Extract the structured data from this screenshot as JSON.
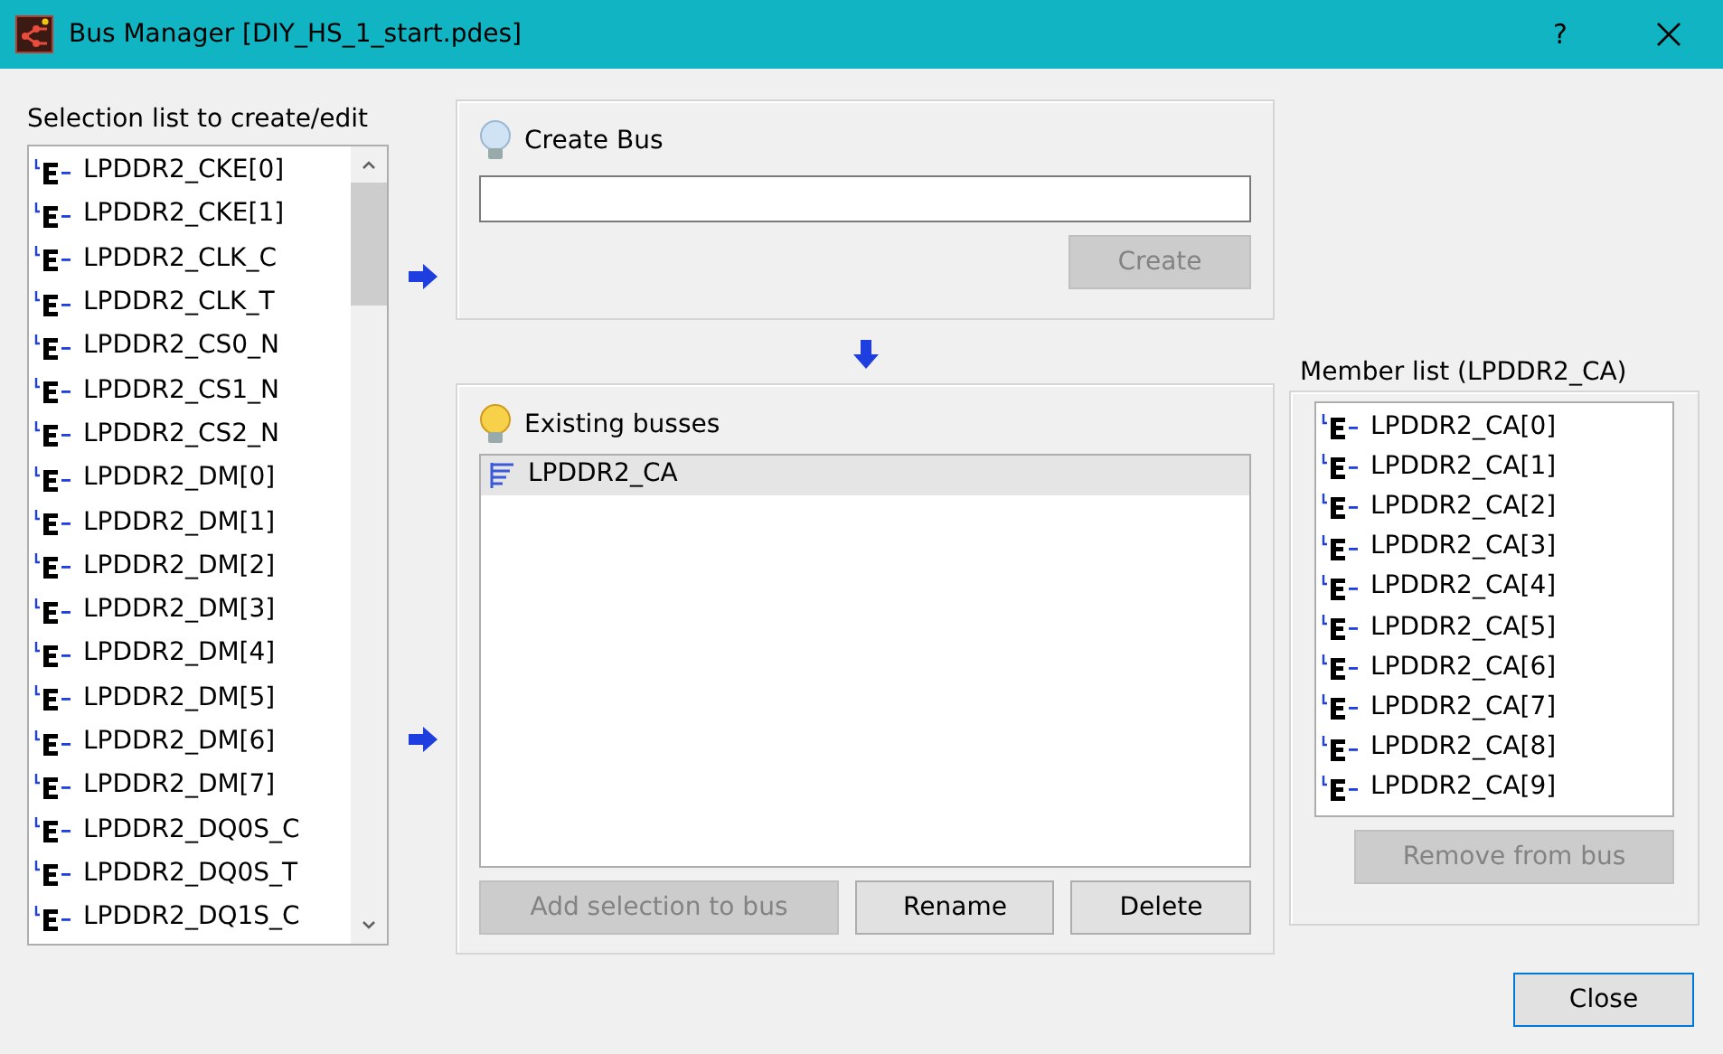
{
  "window": {
    "title": "Bus Manager [DIY_HS_1_start.pdes]",
    "help": "?"
  },
  "selection_list": {
    "label": "Selection list to create/edit",
    "items": [
      {
        "name": "LPDDR2_CKE[0]",
        "selected": false
      },
      {
        "name": "LPDDR2_CKE[1]",
        "selected": false
      },
      {
        "name": "LPDDR2_CLK_C",
        "selected": false
      },
      {
        "name": "LPDDR2_CLK_T",
        "selected": false
      },
      {
        "name": "LPDDR2_CS0_N",
        "selected": false
      },
      {
        "name": "LPDDR2_CS1_N",
        "selected": false
      },
      {
        "name": "LPDDR2_CS2_N",
        "selected": false
      },
      {
        "name": "LPDDR2_DM[0]",
        "selected": false
      },
      {
        "name": "LPDDR2_DM[1]",
        "selected": false
      },
      {
        "name": "LPDDR2_DM[2]",
        "selected": false
      },
      {
        "name": "LPDDR2_DM[3]",
        "selected": false
      },
      {
        "name": "LPDDR2_DM[4]",
        "selected": false
      },
      {
        "name": "LPDDR2_DM[5]",
        "selected": false
      },
      {
        "name": "LPDDR2_DM[6]",
        "selected": false
      },
      {
        "name": "LPDDR2_DM[7]",
        "selected": false
      },
      {
        "name": "LPDDR2_DQ0S_C",
        "selected": false
      },
      {
        "name": "LPDDR2_DQ0S_T",
        "selected": false
      },
      {
        "name": "LPDDR2_DQ1S_C",
        "selected": false
      }
    ]
  },
  "create_bus": {
    "title": "Create Bus",
    "button": {
      "label": "Create",
      "disabled": true
    }
  },
  "existing_busses": {
    "title": "Existing busses",
    "items": [
      {
        "name": "LPDDR2_CA",
        "selected": true
      }
    ],
    "buttons": [
      {
        "label": "Add selection to bus",
        "disabled": true
      },
      {
        "label": "Rename",
        "disabled": false
      },
      {
        "label": "Delete",
        "disabled": false
      }
    ]
  },
  "member_list": {
    "title": "Member list (LPDDR2_CA)",
    "items": [
      {
        "name": "LPDDR2_CA[0]"
      },
      {
        "name": "LPDDR2_CA[1]"
      },
      {
        "name": "LPDDR2_CA[2]"
      },
      {
        "name": "LPDDR2_CA[3]"
      },
      {
        "name": "LPDDR2_CA[4]"
      },
      {
        "name": "LPDDR2_CA[5]"
      },
      {
        "name": "LPDDR2_CA[6]"
      },
      {
        "name": "LPDDR2_CA[7]"
      },
      {
        "name": "LPDDR2_CA[8]"
      },
      {
        "name": "LPDDR2_CA[9]"
      }
    ],
    "button": {
      "label": "Remove from bus",
      "disabled": true
    }
  },
  "close_button": {
    "label": "Close",
    "disabled": false
  }
}
